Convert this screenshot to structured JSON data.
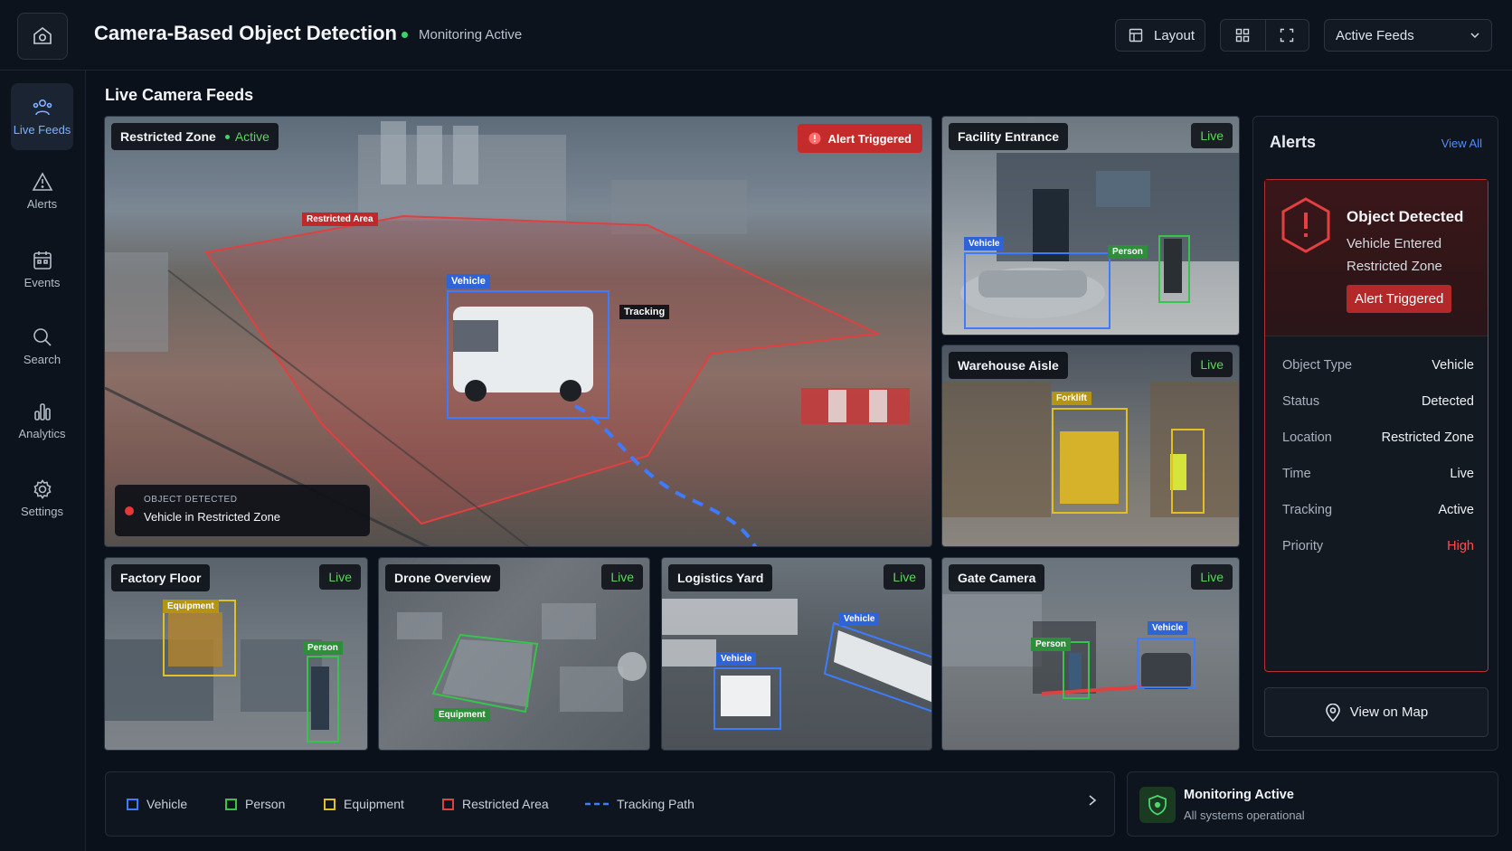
{
  "header": {
    "title": "Camera-Based Object Detection",
    "status": "Monitoring Active",
    "layout_label": "Layout",
    "feeds_dropdown": "Active Feeds"
  },
  "sidebar": {
    "items": [
      {
        "label": "Live Feeds",
        "icon": "users-icon"
      },
      {
        "label": "Alerts",
        "icon": "warning-icon"
      },
      {
        "label": "Events",
        "icon": "calendar-icon"
      },
      {
        "label": "Search",
        "icon": "search-icon"
      },
      {
        "label": "Analytics",
        "icon": "bar-chart-icon"
      },
      {
        "label": "Settings",
        "icon": "gear-icon"
      }
    ]
  },
  "main": {
    "section_title": "Live Camera Feeds",
    "primary_feed": {
      "name": "Restricted Zone",
      "state": "Active",
      "alert": "Alert Triggered",
      "zone_tag": "Restricted Area",
      "vehicle_tag": "Vehicle",
      "tracking_tag": "Tracking",
      "detected_small": "OBJECT DETECTED",
      "detected_text": "Vehicle in Restricted Zone"
    },
    "feeds": [
      {
        "name": "Facility Entrance",
        "live": "Live",
        "tags": [
          "Vehicle",
          "Person"
        ]
      },
      {
        "name": "Warehouse Aisle",
        "live": "Live",
        "tags": [
          "Forklift"
        ]
      },
      {
        "name": "Factory Floor",
        "live": "Live",
        "tags": [
          "Equipment",
          "Person"
        ]
      },
      {
        "name": "Drone Overview",
        "live": "Live",
        "tags": [
          "Equipment"
        ]
      },
      {
        "name": "Logistics Yard",
        "live": "Live",
        "tags": [
          "Vehicle",
          "Vehicle"
        ]
      },
      {
        "name": "Gate Camera",
        "live": "Live",
        "tags": [
          "Person",
          "Vehicle"
        ]
      }
    ]
  },
  "alerts": {
    "title": "Alerts",
    "view_all": "View All",
    "card": {
      "title": "Object Detected",
      "description": "Vehicle Entered Restricted Zone",
      "button": "Alert Triggered",
      "details": [
        {
          "key": "Object Type",
          "value": "Vehicle"
        },
        {
          "key": "Status",
          "value": "Detected"
        },
        {
          "key": "Location",
          "value": "Restricted Zone"
        },
        {
          "key": "Time",
          "value": "Live"
        },
        {
          "key": "Tracking",
          "value": "Active"
        },
        {
          "key": "Priority",
          "value": "High"
        }
      ]
    },
    "map_button": "View on Map"
  },
  "legend": {
    "items": [
      {
        "label": "Vehicle",
        "color": "#3d7bff"
      },
      {
        "label": "Person",
        "color": "#37c44a"
      },
      {
        "label": "Equipment",
        "color": "#e2c023"
      },
      {
        "label": "Restricted Area",
        "color": "#e04040"
      },
      {
        "label": "Tracking Path",
        "color": "#3d7bff"
      }
    ]
  },
  "system_status": {
    "title": "Monitoring Active",
    "subtitle": "All systems operational"
  },
  "colors": {
    "accent": "#4d8dff",
    "alert": "#c42c2c",
    "live": "#5fd35e"
  }
}
